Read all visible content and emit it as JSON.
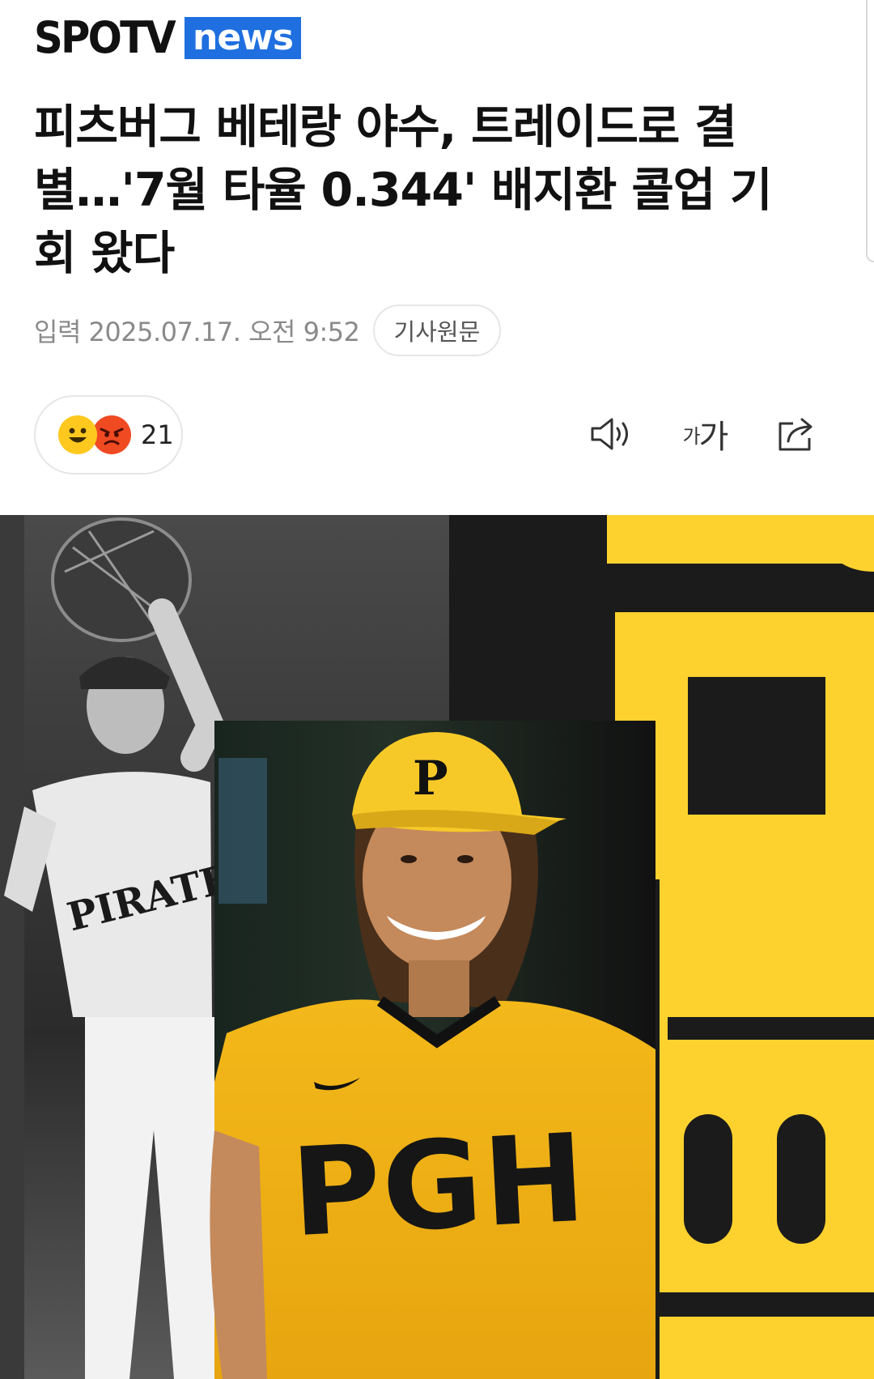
{
  "brand": {
    "spotv": "SPOTV",
    "news": "news"
  },
  "article": {
    "title": "피츠버그 베테랑 야수, 트레이드로 결별…'7월 타율 0.344' 배지환 콜업 기회 왔다",
    "date": "입력 2025.07.17. 오전 9:52",
    "source_button": "기사원문"
  },
  "reactions": {
    "count": "21",
    "icons": [
      "smile-emoji-icon",
      "angry-emoji-icon"
    ]
  },
  "toolbar": {
    "icons": [
      "speaker-icon",
      "font-size-icon",
      "share-icon"
    ],
    "font_size_small": "가",
    "font_size_large": "가"
  },
  "hero_image": {
    "jersey_left": "PIRATES",
    "jersey_right": "PGH",
    "cap_letter": "P",
    "colors": {
      "gold": "#fdd22f",
      "black": "#1b1b1b"
    }
  }
}
